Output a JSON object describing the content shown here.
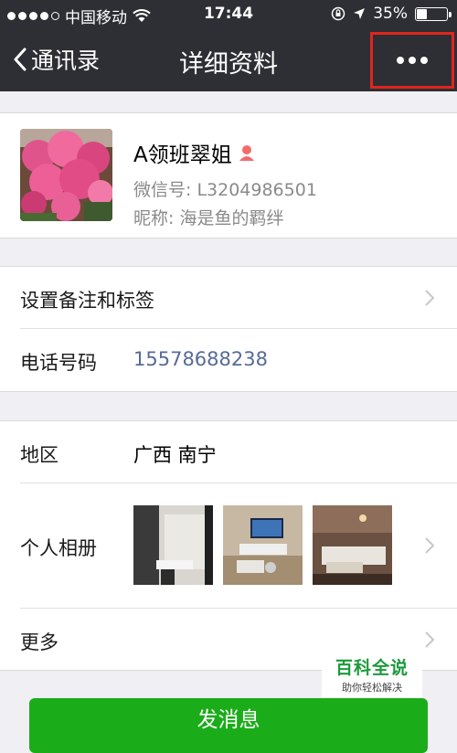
{
  "status_bar": {
    "carrier": "中国移动",
    "time": "17:44",
    "battery": "35%",
    "battery_level": 0.35
  },
  "nav": {
    "back_label": "通讯录",
    "title": "详细资料",
    "more_icon": "more-dots-icon"
  },
  "profile": {
    "name": "A领班翠姐",
    "gender_icon": "female-user-icon",
    "wechat_id": "微信号: L3204986501",
    "nickname": "昵称: 海是鱼的羁绊"
  },
  "rows": {
    "remark_tags": "设置备注和标签",
    "phone_label": "电话号码",
    "phone_value": "15578688238",
    "region_label": "地区",
    "region_value": "广西 南宁",
    "album_label": "个人相册",
    "more_label": "更多"
  },
  "watermark": {
    "title": "百科全说",
    "subtitle": "助你轻松解决"
  },
  "bottom_button": {
    "label": "发消息"
  },
  "colors": {
    "nav_bg": "#2e2f34",
    "phone_link": "#576b95",
    "highlight_box": "#e0251e",
    "button_green": "#1aad19"
  }
}
